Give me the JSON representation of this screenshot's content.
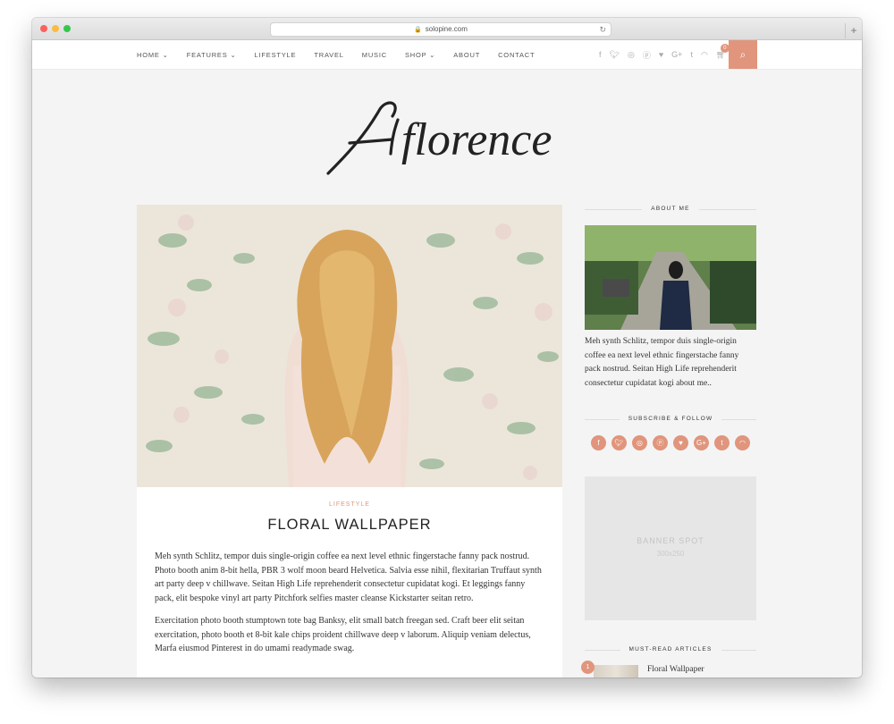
{
  "browser": {
    "url": "solopine.com"
  },
  "nav": {
    "items": [
      {
        "label": "HOME",
        "caret": "⌄",
        "active": true
      },
      {
        "label": "FEATURES",
        "caret": "⌄"
      },
      {
        "label": "LIFESTYLE"
      },
      {
        "label": "TRAVEL"
      },
      {
        "label": "MUSIC"
      },
      {
        "label": "SHOP",
        "caret": "⌄"
      },
      {
        "label": "ABOUT"
      },
      {
        "label": "CONTACT"
      }
    ],
    "social_icons": [
      "facebook-icon",
      "twitter-icon",
      "instagram-icon",
      "pinterest-icon",
      "bloglovin-icon",
      "google-plus-icon",
      "tumblr-icon",
      "rss-icon"
    ],
    "cart_count": "0"
  },
  "logo": {
    "text": "florence"
  },
  "post": {
    "category": "LIFESTYLE",
    "title": "FLORAL WALLPAPER",
    "paragraphs": [
      "Meh synth Schlitz, tempor duis single-origin coffee ea next level ethnic fingerstache fanny pack nostrud. Photo booth anim 8-bit hella, PBR 3 wolf moon beard Helvetica. Salvia esse nihil, flexitarian Truffaut synth art party deep v chillwave. Seitan High Life reprehenderit consectetur cupidatat kogi. Et leggings fanny pack, elit bespoke vinyl art party Pitchfork selfies master cleanse Kickstarter seitan retro.",
      "Exercitation photo booth stumptown tote bag Banksy, elit small batch freegan sed. Craft beer elit seitan exercitation, photo booth et 8-bit kale chips proident chillwave deep v laborum. Aliquip veniam delectus, Marfa eiusmod Pinterest in do umami readymade swag."
    ]
  },
  "sidebar": {
    "about_heading": "ABOUT ME",
    "about_text": "Meh synth Schlitz, tempor duis single-origin coffee ea next level ethnic fingerstache fanny pack nostrud. Seitan High Life reprehenderit consectetur cupidatat kogi about me..",
    "subscribe_heading": "SUBSCRIBE & FOLLOW",
    "banner_line1": "BANNER SPOT",
    "banner_line2": "300x250",
    "must_read_heading": "MUST-READ ARTICLES",
    "must_read": [
      {
        "num": "1",
        "title": "Floral Wallpaper"
      }
    ]
  },
  "colors": {
    "accent": "#e0957c",
    "page_bg": "#f4f4f4"
  }
}
